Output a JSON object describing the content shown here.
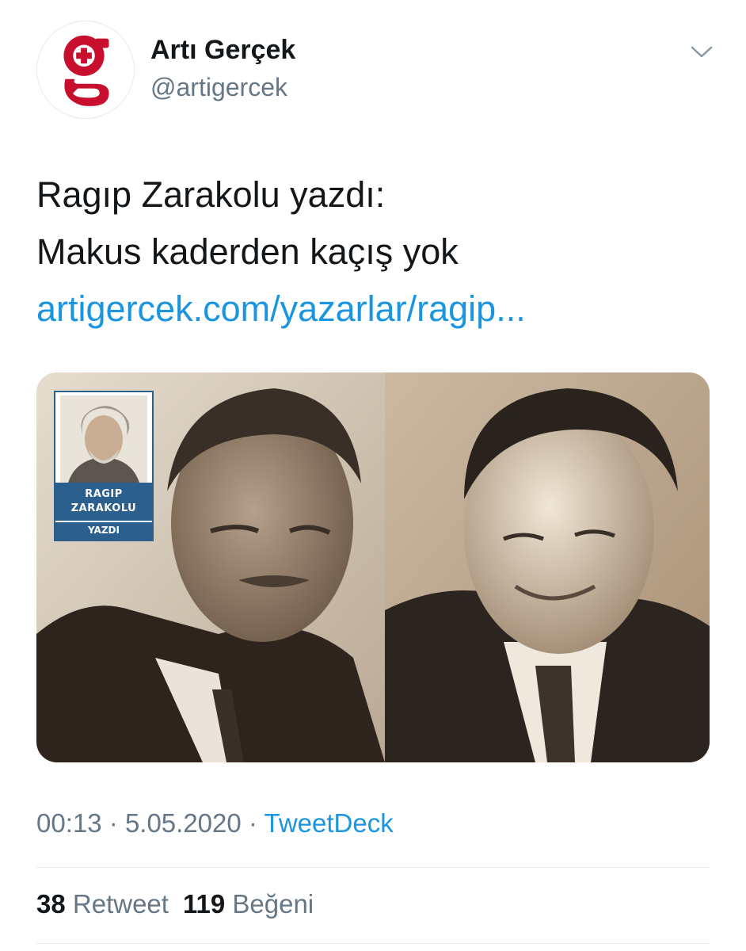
{
  "account": {
    "display_name": "Artı Gerçek",
    "handle": "@artigercek",
    "avatar_icon": "artigercek-logo",
    "brand_color": "#c8102e"
  },
  "tweet": {
    "lines": [
      "Ragıp Zarakolu yazdı:",
      "Makus kaderden kaçış yok"
    ],
    "link_text": "artigercek.com/yazarlar/ragip..."
  },
  "media": {
    "badge": {
      "name_line1": "RAGIP",
      "name_line2": "ZARAKOLU",
      "label": "YAZDI"
    }
  },
  "meta": {
    "time": "00:13",
    "separator": "·",
    "date": "5.05.2020",
    "source": "TweetDeck"
  },
  "stats": {
    "retweet_count": "38",
    "retweet_label": "Retweet",
    "like_count": "119",
    "like_label": "Beğeni"
  },
  "colors": {
    "link": "#1b95e0",
    "secondary_text": "#657786",
    "primary_text": "#14171a",
    "divider": "#e6ecf0"
  }
}
